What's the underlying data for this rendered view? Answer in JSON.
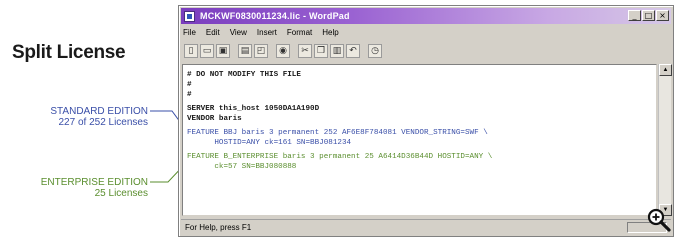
{
  "heading": "Split License",
  "callouts": {
    "standard": {
      "line1": "STANDARD EDITION",
      "line2": "227 of 252 Licenses",
      "color": "#3a4fa8"
    },
    "enterprise": {
      "line1": "ENTERPRISE EDITION",
      "line2": "25 Licenses",
      "color": "#5a8e2e"
    }
  },
  "window": {
    "title": "MCKWF0830011234.lic - WordPad",
    "controls": {
      "minimize": "_",
      "maximize": "□",
      "close": "×"
    },
    "menu": [
      "File",
      "Edit",
      "View",
      "Insert",
      "Format",
      "Help"
    ],
    "toolbar_icons": [
      "new-icon",
      "open-icon",
      "save-icon",
      "print-icon",
      "print-preview-icon",
      "find-icon",
      "cut-icon",
      "copy-icon",
      "paste-icon",
      "undo-icon",
      "date-time-icon"
    ],
    "document_lines": [
      {
        "text": "# DO NOT MODIFY THIS FILE",
        "style": "black"
      },
      {
        "text": "#",
        "style": "black"
      },
      {
        "text": "#",
        "style": "black"
      },
      {
        "text": "SERVER this_host 1050DA1A190D",
        "style": "black"
      },
      {
        "text": "VENDOR baris",
        "style": "black"
      },
      {
        "text": "FEATURE BBJ baris 3 permanent 252 AF6E8F784081 VENDOR_STRING=SWF \\",
        "style": "blue"
      },
      {
        "text": "      HOSTID=ANY ck=161 SN=BBJ081234",
        "style": "blue"
      },
      {
        "text": "FEATURE B_ENTERPRISE baris 3 permanent 25 A6414D36B44D HOSTID=ANY \\",
        "style": "green"
      },
      {
        "text": "      ck=57 SN=BBJ080888",
        "style": "green"
      }
    ],
    "status": "For Help, press F1"
  },
  "colors": {
    "standard": "#3a4fa8",
    "enterprise": "#5a8e2e",
    "titlebar": "#7a3dbe"
  }
}
